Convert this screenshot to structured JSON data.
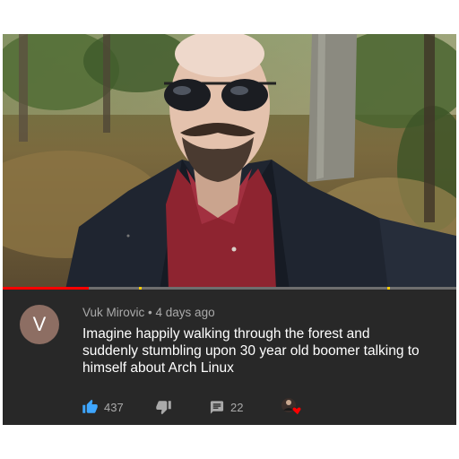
{
  "comment": {
    "avatar_letter": "V",
    "author": "Vuk Mirovic",
    "separator": "•",
    "time": "4 days ago",
    "text": "Imagine happily walking through the forest and suddenly stumbling upon 30 year old boomer talking to himself about Arch Linux",
    "likes": "437",
    "replies": "22"
  },
  "video": {
    "progress": 0.19
  },
  "colors": {
    "panel": "#282828",
    "accent_like": "#3ea6ff",
    "progress": "#ff0000",
    "heart": "#ff0000"
  },
  "icons": [
    "thumbs-up-icon",
    "thumbs-down-icon",
    "reply-icon",
    "creator-heart-icon",
    "more-vert-icon"
  ]
}
